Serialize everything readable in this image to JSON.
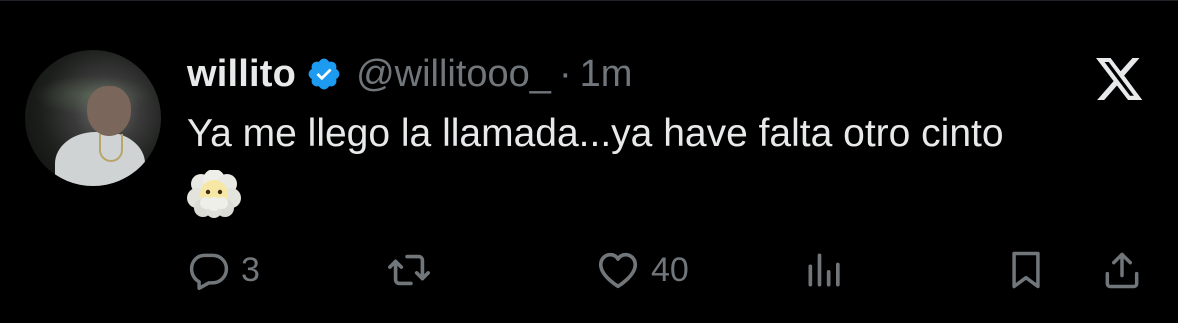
{
  "tweet": {
    "display_name": "willito",
    "handle": "@willitooo_",
    "separator": "·",
    "time": "1m",
    "text": "Ya me llego la llamada...ya have falta otro cinto",
    "emoji": "face-in-clouds"
  },
  "actions": {
    "reply_count": "3",
    "retweet_count": "",
    "like_count": "40"
  },
  "icons": {
    "verified": "verified-badge-icon",
    "platform_logo": "x-logo-icon",
    "reply": "reply-icon",
    "retweet": "retweet-icon",
    "like": "heart-icon",
    "views": "views-icon",
    "bookmark": "bookmark-icon",
    "share": "share-icon"
  },
  "colors": {
    "background": "#000000",
    "text_primary": "#e7e9ea",
    "text_secondary": "#71767b",
    "verified_blue": "#1d9bf0"
  }
}
